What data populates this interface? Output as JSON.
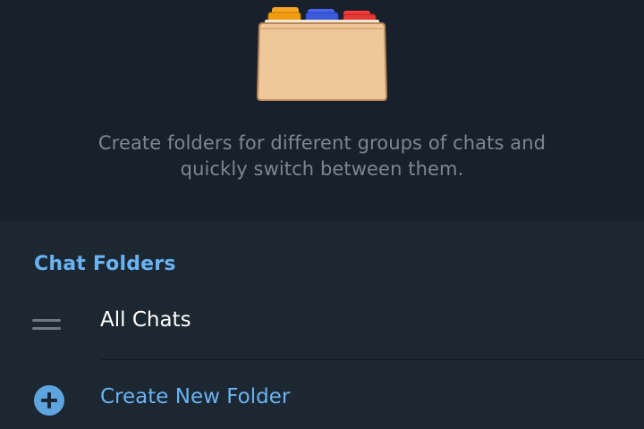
{
  "hero": {
    "illustration_icon": "folder-with-tabs-icon",
    "description_line1": "Create folders for different groups of chats and",
    "description_line2": "quickly switch between them."
  },
  "chat_folders": {
    "header": "Chat Folders",
    "items": [
      {
        "label": "All Chats",
        "icon": "drag-handle-icon"
      }
    ],
    "create_label": "Create New Folder",
    "create_icon": "plus-circle-icon"
  },
  "colors": {
    "hero_bg": "#18212b",
    "section_bg": "#1d2732",
    "accent": "#6ab3f3",
    "muted_text": "#7d8792",
    "tab_orange": "#f39c12",
    "tab_blue": "#3b5bdb",
    "tab_red": "#e53935",
    "folder_body": "#eec89a"
  }
}
